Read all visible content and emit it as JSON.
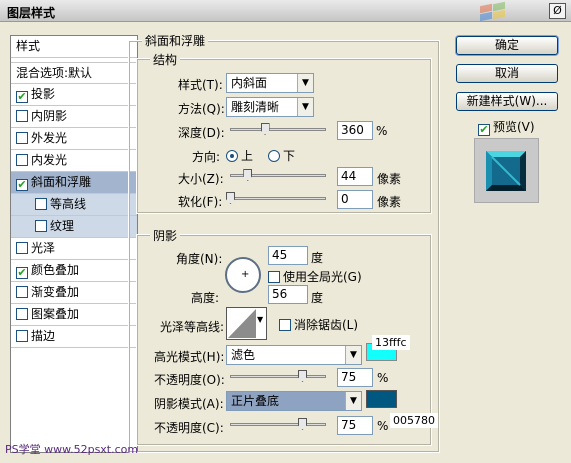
{
  "window": {
    "title": "图层样式",
    "close_glyph": "Ø"
  },
  "left_panel": {
    "header": "样式",
    "blend": "混合选项:默认",
    "items": [
      {
        "label": "投影",
        "checked": true
      },
      {
        "label": "内阴影",
        "checked": false
      },
      {
        "label": "外发光",
        "checked": false
      },
      {
        "label": "内发光",
        "checked": false
      },
      {
        "label": "斜面和浮雕",
        "checked": true
      },
      {
        "label": "等高线",
        "checked": false
      },
      {
        "label": "纹理",
        "checked": false
      },
      {
        "label": "光泽",
        "checked": false
      },
      {
        "label": "颜色叠加",
        "checked": true
      },
      {
        "label": "渐变叠加",
        "checked": false
      },
      {
        "label": "图案叠加",
        "checked": false
      },
      {
        "label": "描边",
        "checked": false
      }
    ]
  },
  "bevel": {
    "title": "斜面和浮雕",
    "structure": {
      "title": "结构",
      "style_label": "样式(T):",
      "style_value": "内斜面",
      "method_label": "方法(Q):",
      "method_value": "雕刻清晰",
      "depth_label": "深度(D):",
      "depth_value": "360",
      "depth_unit": "%",
      "depth_level": 0.36,
      "direction_label": "方向:",
      "dir_up": "上",
      "dir_down": "下",
      "size_label": "大小(Z):",
      "size_value": "44",
      "size_unit": "像素",
      "size_level": 0.18,
      "soften_label": "软化(F):",
      "soften_value": "0",
      "soften_unit": "像素",
      "soften_level": 0.0
    },
    "shading": {
      "title": "阴影",
      "angle_label": "角度(N):",
      "angle_value": "45",
      "angle_unit": "度",
      "global_light": "使用全局光(G)",
      "altitude_label": "高度:",
      "altitude_value": "56",
      "altitude_unit": "度",
      "gloss_label": "光泽等高线:",
      "anti_alias": "消除锯齿(L)",
      "highlight_label": "高光模式(H):",
      "highlight_mode": "滤色",
      "highlight_color": "#13fffc",
      "highlight_hex": "13fffc",
      "hl_opacity_label": "不透明度(O):",
      "hl_opacity_value": "75",
      "hl_opacity_unit": "%",
      "hl_opacity_level": 0.75,
      "shadow_label": "阴影模式(A):",
      "shadow_mode": "正片叠底",
      "shadow_color": "#005780",
      "shadow_hex": "005780",
      "sh_opacity_label": "不透明度(C):",
      "sh_opacity_value": "75",
      "sh_opacity_unit": "%",
      "sh_opacity_level": 0.75
    }
  },
  "buttons": {
    "ok": "确定",
    "cancel": "取消",
    "new_style": "新建样式(W)...",
    "preview": "预览(V)"
  },
  "watermark": "PS学堂 www.52psxt.com"
}
